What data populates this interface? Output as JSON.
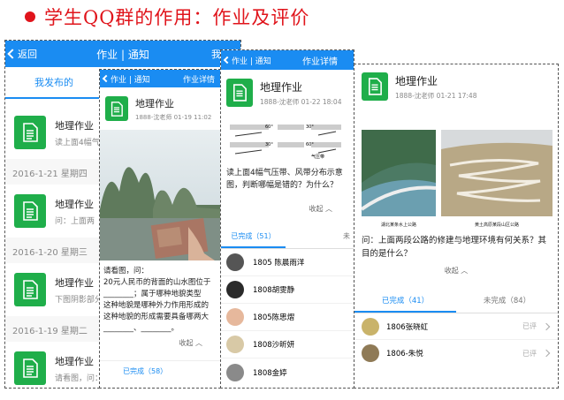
{
  "heading": "学生QQ群的作用：作业及评价",
  "colors": {
    "accent": "#1a8cf2",
    "doc_green": "#1fae4a",
    "heading_red": "#e0141b"
  },
  "p1": {
    "back": "返回",
    "title": "作业 | 通知",
    "right": "我要发",
    "tab": "我发布的",
    "items": [
      {
        "name": "地理作业",
        "desc": "读上面4幅气压"
      },
      {
        "date": "2016-1-21 星期四",
        "name": "地理作业",
        "desc": "问：上面两"
      },
      {
        "date": "2016-1-20 星期三",
        "name": "地理作业",
        "desc": "下图阴影部分"
      },
      {
        "date": "2016-1-19 星期二",
        "name": "地理作业",
        "desc": "请看图，问："
      }
    ]
  },
  "p2": {
    "back": "作业 | 通知",
    "title": "作业详情",
    "name": "地理作业",
    "meta": "1888-沈老师 01-19 11:02",
    "q1": "请看图，问：",
    "q2": "20元人民币的背面的山水图位于",
    "q3": "________；属于哪种地貌类型",
    "q4": "这种地貌是哪种外力作用形成的",
    "q5": "这种地貌的形成需要具备哪两大",
    "q6": "________、________。",
    "collapse": "收起",
    "done": "已完成（58）"
  },
  "p3": {
    "back": "作业 | 通知",
    "title": "作业详情",
    "name": "地理作业",
    "meta": "1888-沈老师 01-22 18:04",
    "diagram": {
      "angles": [
        "60°",
        "30°",
        "30°",
        "60°"
      ],
      "label": "气压带"
    },
    "q": "读上面4幅气压带、风带分布示意图，判断哪幅是错的？为什么？",
    "collapse": "收起",
    "tab_done": "已完成（51）",
    "tab_undone": "未",
    "students": [
      "1805 陈晨雨洋",
      "1808胡雯静",
      "1805陈思熠",
      "1808沙昕妍",
      "1808金婷"
    ]
  },
  "p4": {
    "name": "地理作业",
    "meta": "1888-沈老师 01-21 17:48",
    "cap1": "湖北某条水上公路",
    "cap2": "黄土高原某段山区公路",
    "q": "问：上面两段公路的修建与地理环境有何关系？其目的是什么？",
    "collapse": "收起",
    "tab_done": "已完成（41）",
    "tab_undone": "未完成（84）",
    "students": [
      {
        "name": "1806张晓虹",
        "status": "已评"
      },
      {
        "name": "1806-朱悦",
        "status": "已评"
      }
    ]
  }
}
